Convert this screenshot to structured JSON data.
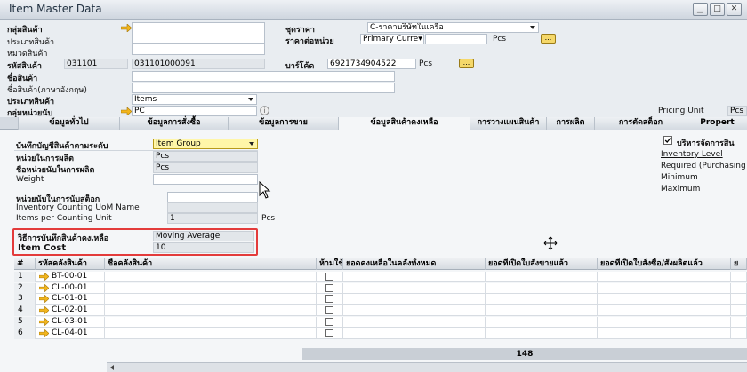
{
  "window": {
    "title": "Item Master Data"
  },
  "header": {
    "item_group_label": "กลุ่มสินค้า",
    "item_type_label": "ประเภทสินค้า",
    "item_category_label": "หมวดสินค้า",
    "item_code_label": "รหัสสินค้า",
    "item_code_short": "031101",
    "item_code_full": "031101000091",
    "item_name_label": "ชื่อสินค้า",
    "item_foreign_name_label": "ชื่อสินค้า(ภาษาอังกฤษ)",
    "item_class_label": "ประเภทสินค้า",
    "item_class_value": "Items",
    "uom_group_label": "กลุ่มหน่วยนับ",
    "uom_group_value": "PC",
    "price_list_label": "ชุดราคา",
    "price_list_value": "C-ราคาบริษัทในเครือ",
    "unit_price_label": "ราคาต่อหน่วย",
    "unit_price_currency": "Primary Curre▾",
    "unit_price_uom": "Pcs",
    "barcode_label": "บาร์โค้ด",
    "barcode_value": "6921734904522",
    "barcode_uom": "Pcs",
    "pricing_unit_label": "Pricing Unit",
    "pricing_unit_value": "Pcs",
    "dots_label": "..."
  },
  "tabs": [
    {
      "label": "ข้อมูลทั่วไป"
    },
    {
      "label": "ข้อมูลการสั่งซื้อ"
    },
    {
      "label": "ข้อมูลการขาย"
    },
    {
      "label": "ข้อมูลสินค้าคงเหลือ"
    },
    {
      "label": "การวางแผนสินค้า"
    },
    {
      "label": "การผลิต"
    },
    {
      "label": "การตัดสต็อก"
    },
    {
      "label": "Propert"
    }
  ],
  "inventory": {
    "gl_by_label": "บันทึกบัญชีสินค้าตามระดับ",
    "gl_by_value": "Item Group",
    "uom_production_label": "หน่วยในการผลิต",
    "uom_production_value": "Pcs",
    "uom_production_name_label": "ชื่อหน่วยนับในการผลิต",
    "uom_production_name_value": "Pcs",
    "weight_label": "Weight",
    "counting_uom_label": "หน่วยนับในการนับสต็อก",
    "counting_uom_name_label": "Inventory Counting UoM Name",
    "items_per_counting_label": "Items per Counting Unit",
    "items_per_counting_value": "1",
    "items_per_counting_uom": "Pcs",
    "valuation_method_label": "วิธีการบันทึกสินค้าคงเหลือ",
    "valuation_method_value": "Moving Average",
    "item_cost_label": "Item Cost",
    "item_cost_value": "10",
    "manage_inventory_label": "บริหารจัดการสิน",
    "inventory_level_label": "Inventory Level",
    "required_label": "Required (Purchasing",
    "minimum_label": "Minimum",
    "maximum_label": "Maximum"
  },
  "grid": {
    "headers": [
      "#",
      "รหัสคลังสินค้า",
      "ชื่อคลังสินค้า",
      "ห้ามใช้",
      "ยอดคงเหลือในคลังทั้งหมด",
      "ยอดที่เปิดใบสั่งขายแล้ว",
      "ยอดที่เปิดใบสั่งซื้อ/สั่งผลิตแล้ว",
      "ย"
    ],
    "rows": [
      {
        "num": "1",
        "code": "BT-00-01"
      },
      {
        "num": "2",
        "code": "CL-00-01"
      },
      {
        "num": "3",
        "code": "CL-01-01"
      },
      {
        "num": "4",
        "code": "CL-02-01"
      },
      {
        "num": "5",
        "code": "CL-03-01"
      },
      {
        "num": "6",
        "code": "CL-04-01"
      }
    ],
    "total": "148"
  }
}
